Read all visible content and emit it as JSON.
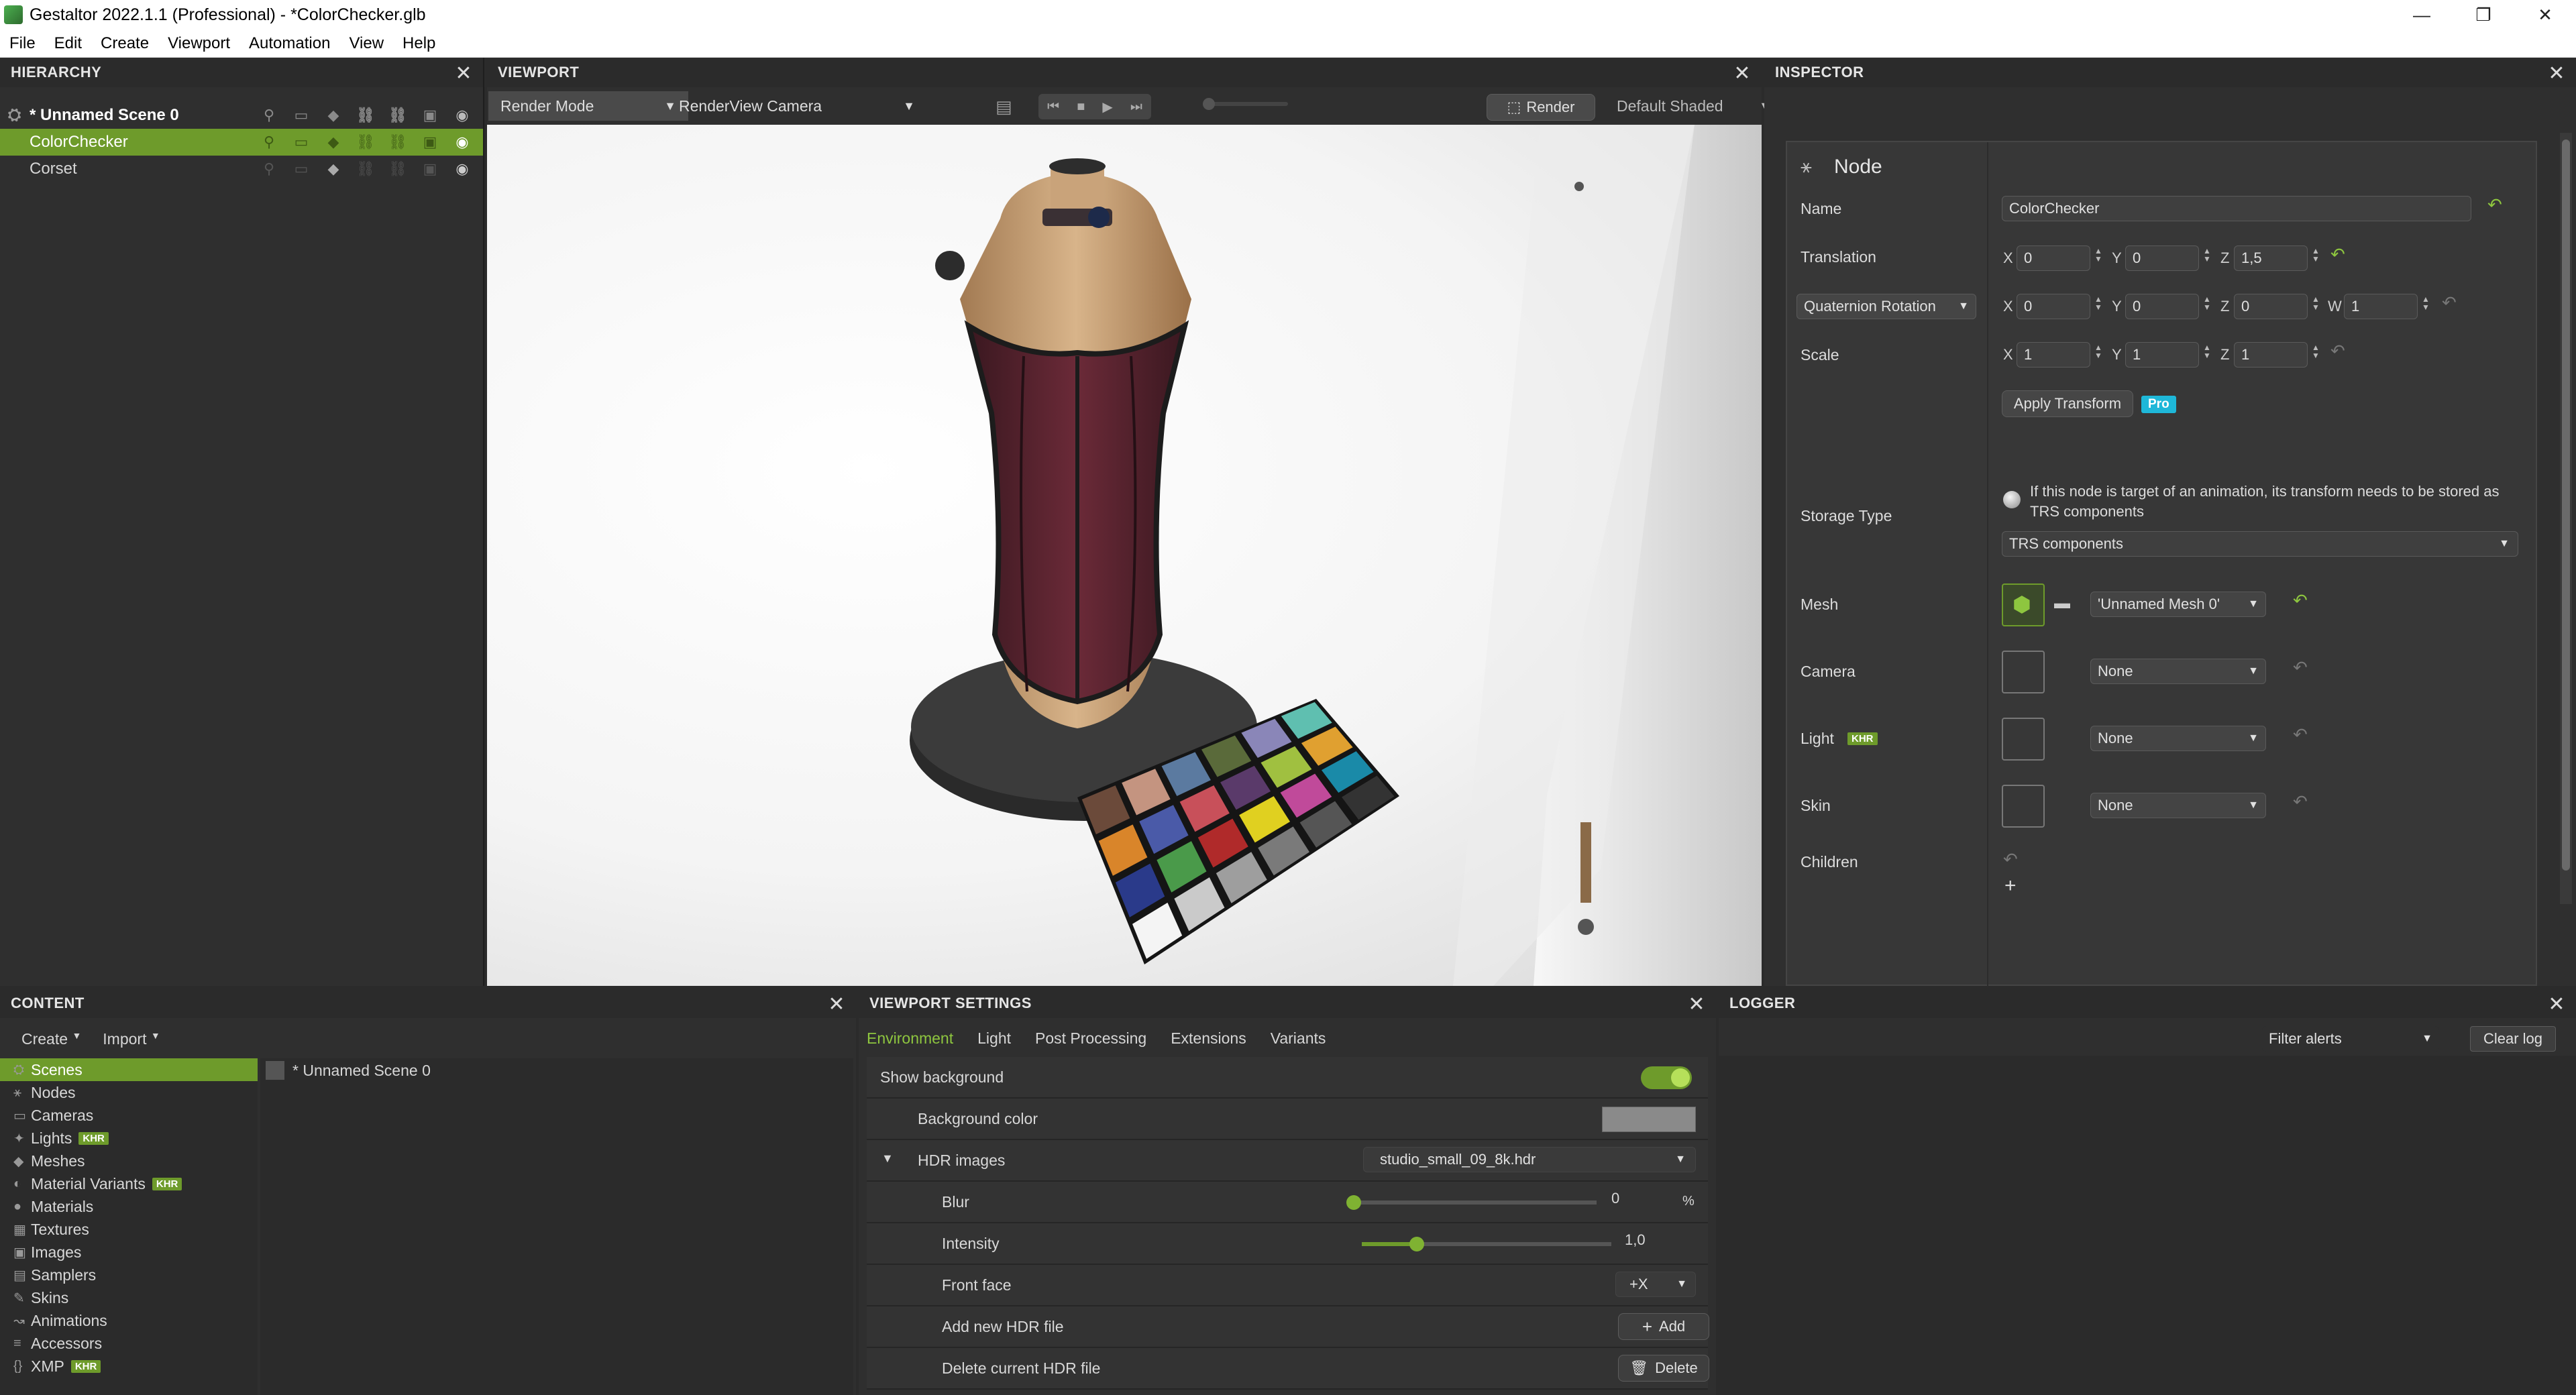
{
  "window": {
    "title": "Gestaltor 2022.1.1 (Professional) - *ColorChecker.glb",
    "minimize": "—",
    "restore": "❐",
    "close": "✕"
  },
  "menu": [
    "File",
    "Edit",
    "Create",
    "Viewport",
    "Automation",
    "View",
    "Help"
  ],
  "hierarchy": {
    "title": "HIERARCHY",
    "scene": "* Unnamed Scene 0",
    "items": [
      "ColorChecker",
      "Corset"
    ]
  },
  "viewport": {
    "title": "VIEWPORT",
    "render_mode": "Render Mode",
    "camera": "RenderView Camera",
    "render_button": "Render",
    "shading": "Default Shaded",
    "playback_progress": 0
  },
  "inspector": {
    "title": "INSPECTOR",
    "node_heading": "Node",
    "name_label": "Name",
    "name_value": "ColorChecker",
    "translation_label": "Translation",
    "translation": {
      "x": "0",
      "y": "0",
      "z": "1,5"
    },
    "rotation_mode": "Quaternion Rotation",
    "rotation": {
      "x": "0",
      "y": "0",
      "z": "0",
      "w": "1"
    },
    "scale_label": "Scale",
    "scale": {
      "x": "1",
      "y": "1",
      "z": "1"
    },
    "apply_transform": "Apply Transform",
    "pro_badge": "Pro",
    "storage_type_label": "Storage Type",
    "storage_note": "If this node is target of an animation, its transform needs to be stored as TRS components",
    "storage_value": "TRS components",
    "mesh_label": "Mesh",
    "mesh_value": "'Unnamed Mesh 0'",
    "camera_label": "Camera",
    "camera_value": "None",
    "light_label": "Light",
    "light_badge": "KHR",
    "light_value": "None",
    "skin_label": "Skin",
    "skin_value": "None",
    "children_label": "Children",
    "add_child": "+"
  },
  "content": {
    "title": "CONTENT",
    "create": "Create",
    "import": "Import",
    "categories": [
      {
        "label": "Scenes",
        "icon": "scenes-icon",
        "badge": ""
      },
      {
        "label": "Nodes",
        "icon": "nodes-icon",
        "badge": ""
      },
      {
        "label": "Cameras",
        "icon": "camera-icon",
        "badge": ""
      },
      {
        "label": "Lights",
        "icon": "light-icon",
        "badge": "KHR"
      },
      {
        "label": "Meshes",
        "icon": "mesh-icon",
        "badge": ""
      },
      {
        "label": "Material Variants",
        "icon": "material-variants-icon",
        "badge": "KHR"
      },
      {
        "label": "Materials",
        "icon": "material-icon",
        "badge": ""
      },
      {
        "label": "Textures",
        "icon": "texture-icon",
        "badge": ""
      },
      {
        "label": "Images",
        "icon": "image-icon",
        "badge": ""
      },
      {
        "label": "Samplers",
        "icon": "sampler-icon",
        "badge": ""
      },
      {
        "label": "Skins",
        "icon": "skin-icon",
        "badge": ""
      },
      {
        "label": "Animations",
        "icon": "animation-icon",
        "badge": ""
      },
      {
        "label": "Accessors",
        "icon": "accessor-icon",
        "badge": ""
      },
      {
        "label": "XMP",
        "icon": "xmp-icon",
        "badge": "KHR"
      }
    ],
    "scene_entry": "* Unnamed Scene 0"
  },
  "viewport_settings": {
    "title": "VIEWPORT SETTINGS",
    "tabs": [
      "Environment",
      "Light",
      "Post Processing",
      "Extensions",
      "Variants"
    ],
    "show_background": "Show background",
    "show_background_on": true,
    "background_color_label": "Background color",
    "background_color": "#8a8a8a",
    "hdr_images": "HDR images",
    "hdr_file": "studio_small_09_8k.hdr",
    "blur_label": "Blur",
    "blur_value": "0",
    "blur_unit": "%",
    "blur_fraction": 0,
    "intensity_label": "Intensity",
    "intensity_value": "1,0",
    "intensity_fraction": 0.22,
    "front_face_label": "Front face",
    "front_face_value": "+X",
    "add_hdr_label": "Add new HDR file",
    "add_button": "Add",
    "delete_hdr_label": "Delete current HDR file",
    "delete_button": "Delete"
  },
  "logger": {
    "title": "LOGGER",
    "filter": "Filter alerts",
    "clear": "Clear log"
  },
  "colors": {
    "accent": "#6e9b2b",
    "panel": "#2f2f2f"
  }
}
